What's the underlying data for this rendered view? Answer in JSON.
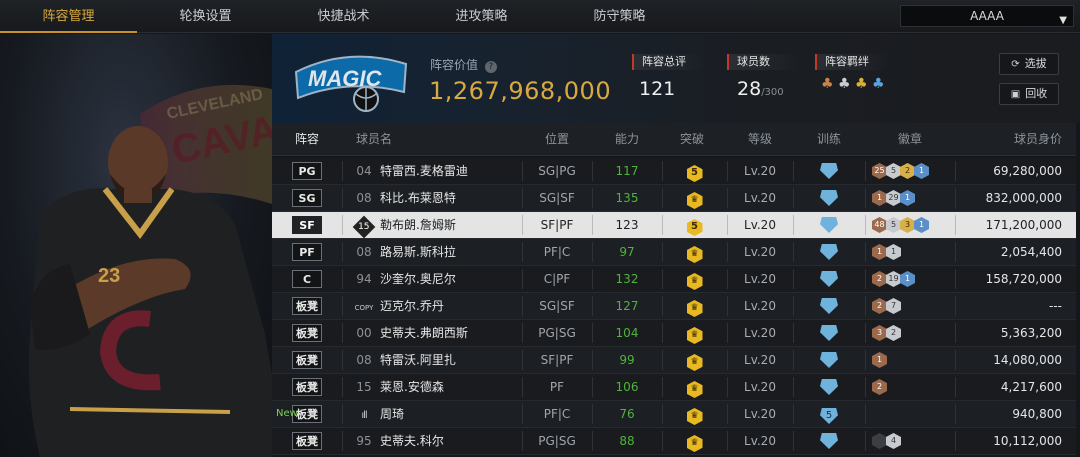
{
  "nav": {
    "tabs": [
      {
        "label": "阵容管理",
        "active": true
      },
      {
        "label": "轮换设置",
        "active": false
      },
      {
        "label": "快捷战术",
        "active": false
      },
      {
        "label": "进攻策略",
        "active": false
      },
      {
        "label": "防守策略",
        "active": false
      }
    ],
    "account": "AAAA"
  },
  "team": {
    "logo_text": "MAGIC",
    "value_label": "阵容价值",
    "value": "1,267,968,000",
    "stats": [
      {
        "label": "阵容总评",
        "value": "121",
        "sub": ""
      },
      {
        "label": "球员数",
        "value": "28",
        "sub": "/300"
      },
      {
        "label": "阵容羁绊",
        "value": "",
        "sub": ""
      }
    ],
    "buttons": {
      "select": "选拔",
      "recycle": "回收"
    }
  },
  "featured_player": {
    "jersey_number": "23",
    "background_text": "CLEVELAND CAVALIERS"
  },
  "columns": [
    "阵容",
    "球员名",
    "位置",
    "能力",
    "突破",
    "等级",
    "训练",
    "徽章",
    "球员身价"
  ],
  "rows": [
    {
      "slot": "PG",
      "num": "04",
      "name": "特雷西.麦格雷迪",
      "pos": "SG|PG",
      "ability": "117",
      "breakthrough": "5",
      "level": "Lv.20",
      "training": "",
      "badges": [
        {
          "t": "bronze",
          "v": "25"
        },
        {
          "t": "silver",
          "v": "5"
        },
        {
          "t": "gold",
          "v": "2"
        },
        {
          "t": "blue",
          "v": "1"
        }
      ],
      "price": "69,280,000"
    },
    {
      "slot": "SG",
      "num": "08",
      "name": "科比.布莱恩特",
      "pos": "SG|SF",
      "ability": "135",
      "breakthrough": "♛",
      "level": "Lv.20",
      "training": "",
      "badges": [
        {
          "t": "bronze",
          "v": "1"
        },
        {
          "t": "silver",
          "v": "29"
        },
        {
          "t": "blue",
          "v": "1"
        }
      ],
      "price": "832,000,000"
    },
    {
      "slot": "SF",
      "num": "15",
      "name": "勒布朗.詹姆斯",
      "pos": "SF|PF",
      "ability": "123",
      "breakthrough": "5",
      "level": "Lv.20",
      "training": "",
      "badges": [
        {
          "t": "bronze",
          "v": "48"
        },
        {
          "t": "silver",
          "v": "5"
        },
        {
          "t": "gold",
          "v": "3"
        },
        {
          "t": "blue",
          "v": "1"
        }
      ],
      "price": "171,200,000",
      "selected": true
    },
    {
      "slot": "PF",
      "num": "08",
      "name": "路易斯.斯科拉",
      "pos": "PF|C",
      "ability": "97",
      "breakthrough": "♛",
      "level": "Lv.20",
      "training": "",
      "badges": [
        {
          "t": "bronze",
          "v": "1"
        },
        {
          "t": "silver",
          "v": "1"
        }
      ],
      "price": "2,054,400"
    },
    {
      "slot": "C",
      "num": "94",
      "name": "沙奎尔.奥尼尔",
      "pos": "C|PF",
      "ability": "132",
      "breakthrough": "♛",
      "level": "Lv.20",
      "training": "",
      "badges": [
        {
          "t": "bronze",
          "v": "2"
        },
        {
          "t": "silver",
          "v": "19"
        },
        {
          "t": "blue",
          "v": "1"
        }
      ],
      "price": "158,720,000"
    },
    {
      "slot": "板凳",
      "num": "COPY",
      "name": "迈克尔.乔丹",
      "pos": "SG|SF",
      "ability": "127",
      "breakthrough": "♛",
      "level": "Lv.20",
      "training": "",
      "badges": [
        {
          "t": "bronze",
          "v": "2"
        },
        {
          "t": "silver",
          "v": "7"
        }
      ],
      "price": "---"
    },
    {
      "slot": "板凳",
      "num": "00",
      "name": "史蒂夫.弗朗西斯",
      "pos": "PG|SG",
      "ability": "104",
      "breakthrough": "♛",
      "level": "Lv.20",
      "training": "",
      "badges": [
        {
          "t": "bronze",
          "v": "3"
        },
        {
          "t": "silver",
          "v": "2"
        }
      ],
      "price": "5,363,200"
    },
    {
      "slot": "板凳",
      "num": "08",
      "name": "特雷沃.阿里扎",
      "pos": "SF|PF",
      "ability": "99",
      "breakthrough": "♛",
      "level": "Lv.20",
      "training": "",
      "badges": [
        {
          "t": "bronze",
          "v": "1"
        }
      ],
      "price": "14,080,000"
    },
    {
      "slot": "板凳",
      "num": "15",
      "name": "莱恩.安德森",
      "pos": "PF",
      "ability": "106",
      "breakthrough": "♛",
      "level": "Lv.20",
      "training": "",
      "badges": [
        {
          "t": "bronze",
          "v": "2"
        }
      ],
      "price": "4,217,600"
    },
    {
      "slot": "板凳",
      "num": "ıll",
      "name": "周琦",
      "pos": "PF|C",
      "ability": "76",
      "breakthrough": "♛",
      "level": "Lv.20",
      "training": "5",
      "badges": [],
      "price": "940,800",
      "new": "New"
    },
    {
      "slot": "板凳",
      "num": "95",
      "name": "史蒂夫.科尔",
      "pos": "PG|SG",
      "ability": "88",
      "breakthrough": "♛",
      "level": "Lv.20",
      "training": "",
      "badges": [
        {
          "t": "dark",
          "v": ""
        },
        {
          "t": "silver",
          "v": "4"
        }
      ],
      "price": "10,112,000"
    }
  ],
  "colors": {
    "accent": "#c8922a",
    "gold_value": "#d9a93f",
    "ability_green": "#4fb43b",
    "selected_row": "#e4e4e4",
    "stat_marker": "#c0392b"
  }
}
